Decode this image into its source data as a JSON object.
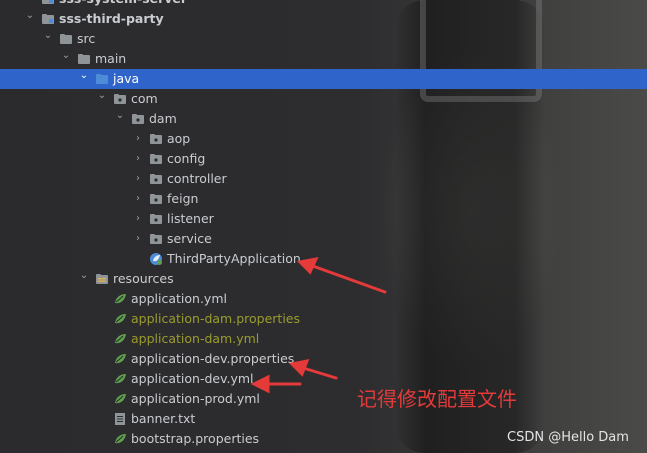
{
  "tree": [
    {
      "label": "sss-system-server",
      "depth": 1,
      "type": "module",
      "expanded": false,
      "bold": true
    },
    {
      "label": "sss-third-party",
      "depth": 1,
      "type": "module",
      "expanded": true,
      "bold": true
    },
    {
      "label": "src",
      "depth": 2,
      "type": "folder",
      "expanded": true
    },
    {
      "label": "main",
      "depth": 3,
      "type": "folder",
      "expanded": true
    },
    {
      "label": "java",
      "depth": 4,
      "type": "source-folder",
      "expanded": true,
      "selected": true
    },
    {
      "label": "com",
      "depth": 5,
      "type": "package",
      "expanded": true
    },
    {
      "label": "dam",
      "depth": 6,
      "type": "package",
      "expanded": true
    },
    {
      "label": "aop",
      "depth": 7,
      "type": "package",
      "expanded": false
    },
    {
      "label": "config",
      "depth": 7,
      "type": "package",
      "expanded": false
    },
    {
      "label": "controller",
      "depth": 7,
      "type": "package",
      "expanded": false
    },
    {
      "label": "feign",
      "depth": 7,
      "type": "package",
      "expanded": false
    },
    {
      "label": "listener",
      "depth": 7,
      "type": "package",
      "expanded": false
    },
    {
      "label": "service",
      "depth": 7,
      "type": "package",
      "expanded": false
    },
    {
      "label": "ThirdPartyApplication",
      "depth": 7,
      "type": "spring-class",
      "leaf": true
    },
    {
      "label": "resources",
      "depth": 4,
      "type": "resources-folder",
      "expanded": true
    },
    {
      "label": "application.yml",
      "depth": 5,
      "type": "spring-config",
      "leaf": true
    },
    {
      "label": "application-dam.properties",
      "depth": 5,
      "type": "spring-config",
      "leaf": true,
      "olive": true
    },
    {
      "label": "application-dam.yml",
      "depth": 5,
      "type": "spring-config",
      "leaf": true,
      "olive": true
    },
    {
      "label": "application-dev.properties",
      "depth": 5,
      "type": "spring-config",
      "leaf": true
    },
    {
      "label": "application-dev.yml",
      "depth": 5,
      "type": "spring-config",
      "leaf": true
    },
    {
      "label": "application-prod.yml",
      "depth": 5,
      "type": "spring-config",
      "leaf": true
    },
    {
      "label": "banner.txt",
      "depth": 5,
      "type": "text-file",
      "leaf": true
    },
    {
      "label": "bootstrap.properties",
      "depth": 5,
      "type": "spring-config",
      "leaf": true
    }
  ],
  "annotation": {
    "text": "记得修改配置文件",
    "color": "#e43a3a"
  },
  "watermark": "CSDN @Hello Dam",
  "colors": {
    "selection": "#2f65ca",
    "folder": "#8f9499",
    "source_folder": "#4d8cd8",
    "spring": "#5fa04e",
    "olive_text": "#9b9b2e"
  }
}
